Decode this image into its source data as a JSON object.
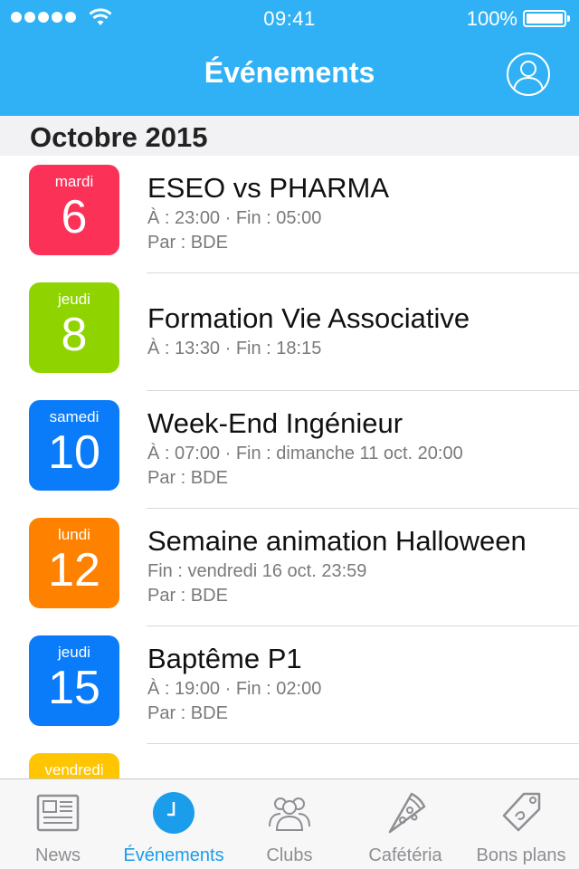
{
  "status_bar": {
    "time": "09:41",
    "battery": "100%",
    "signal_icon": "signal-dots-icon",
    "wifi_icon": "wifi-icon"
  },
  "nav": {
    "title": "Événements",
    "profile_icon": "user-profile-icon"
  },
  "section": {
    "title": "Octobre 2015"
  },
  "events": [
    {
      "weekday": "mardi",
      "day": "6",
      "color": "#fc3158",
      "title": "ESEO vs PHARMA",
      "time_line": "À : 23:00  ·  Fin : 05:00",
      "by_line": "Par : BDE"
    },
    {
      "weekday": "jeudi",
      "day": "8",
      "color": "#8fd400",
      "title": "Formation Vie Associative",
      "time_line": "À : 13:30  ·  Fin : 18:15",
      "by_line": ""
    },
    {
      "weekday": "samedi",
      "day": "10",
      "color": "#0a7cfa",
      "title": "Week-End Ingénieur",
      "time_line": "À : 07:00  ·  Fin : dimanche 11 oct. 20:00",
      "by_line": "Par : BDE"
    },
    {
      "weekday": "lundi",
      "day": "12",
      "color": "#fe8200",
      "title": "Semaine animation Halloween",
      "time_line": "Fin : vendredi 16 oct. 23:59",
      "by_line": "Par : BDE"
    },
    {
      "weekday": "jeudi",
      "day": "15",
      "color": "#0a7cfa",
      "title": "Baptême P1",
      "time_line": "À : 19:00  ·  Fin : 02:00",
      "by_line": "Par : BDE"
    },
    {
      "weekday": "vendredi",
      "day": "",
      "color": "#ffc500",
      "title": "",
      "time_line": "",
      "by_line": ""
    }
  ],
  "tabs": [
    {
      "label": "News",
      "icon": "newspaper-icon",
      "active": false
    },
    {
      "label": "Événements",
      "icon": "clock-icon",
      "active": true
    },
    {
      "label": "Clubs",
      "icon": "group-people-icon",
      "active": false
    },
    {
      "label": "Cafétéria",
      "icon": "pizza-slice-icon",
      "active": false
    },
    {
      "label": "Bons plans",
      "icon": "price-tag-icon",
      "active": false
    }
  ],
  "colors": {
    "header": "#31b1f5",
    "tab_active": "#1a9dea",
    "tab_inactive": "#8e8e93"
  }
}
